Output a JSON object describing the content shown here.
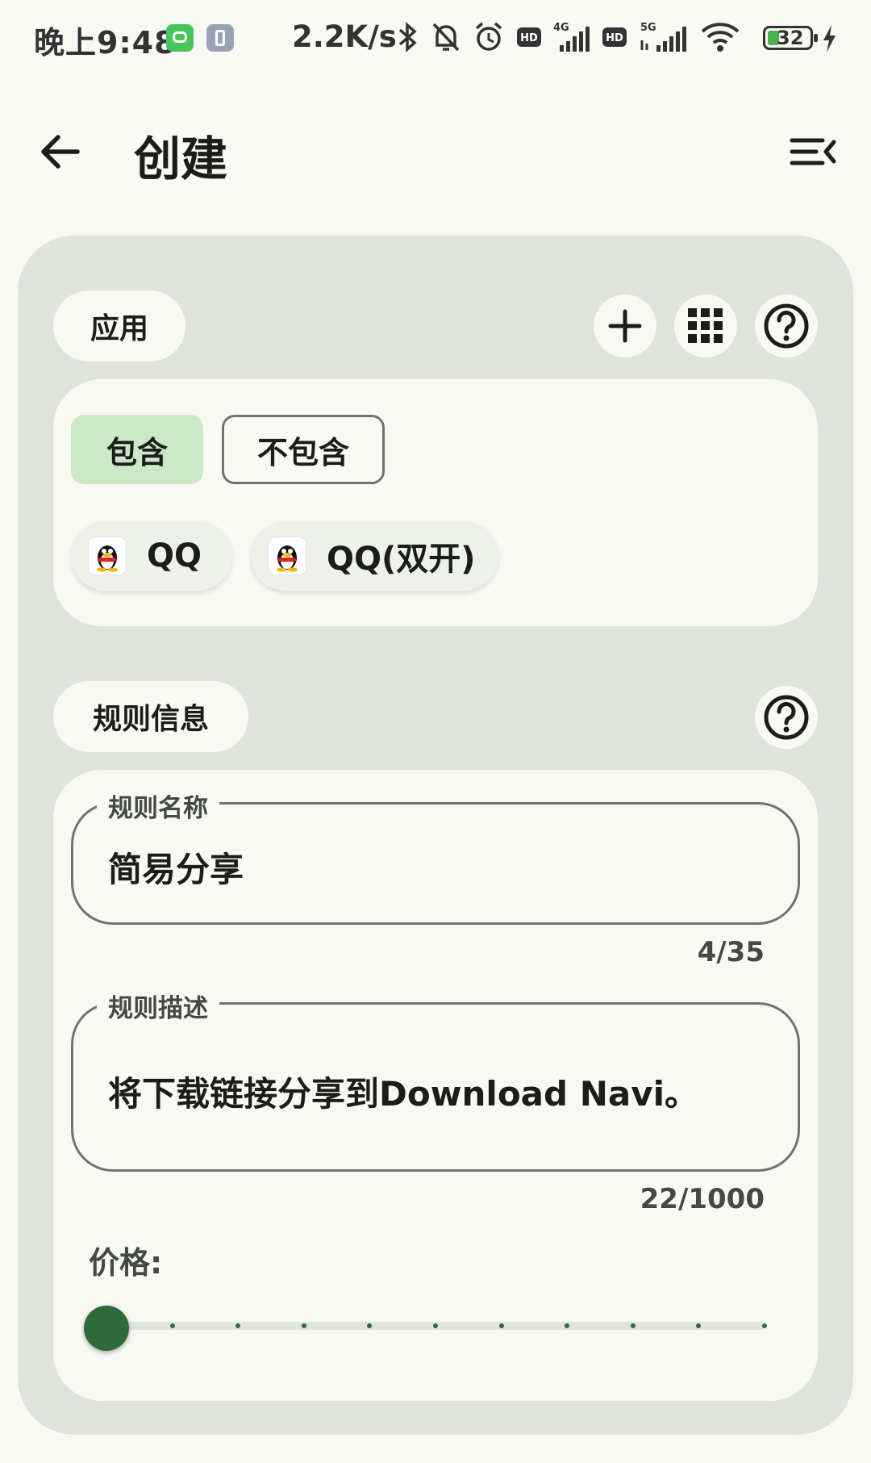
{
  "status_bar": {
    "time": "晚上9:48",
    "net_speed": "2.2K/s",
    "network_labels": [
      "4G",
      "5G"
    ],
    "hd_label": "HD",
    "battery_level": "32",
    "icons": [
      "bluetooth-icon",
      "mute-bell-icon",
      "alarm-icon",
      "hd-icon",
      "signal-4g-icon",
      "signal-5g-icon",
      "wifi-icon",
      "battery-icon",
      "charging-icon"
    ]
  },
  "topbar": {
    "title": "创建",
    "back_icon": "arrow-left-icon",
    "menu_icon": "menu-collapse-icon"
  },
  "apps_section": {
    "header": "应用",
    "actions": [
      "add-icon",
      "grid-icon",
      "help-icon"
    ],
    "filter_chips": [
      {
        "label": "包含",
        "selected": true
      },
      {
        "label": "不包含",
        "selected": false
      }
    ],
    "apps": [
      {
        "name": "QQ",
        "icon": "qq-penguin-icon"
      },
      {
        "name": "QQ(双开)",
        "icon": "qq-penguin-icon"
      }
    ]
  },
  "rule_section": {
    "header": "规则信息",
    "help_icon": "help-icon",
    "name_field": {
      "label": "规则名称",
      "value": "简易分享",
      "counter": "4/35"
    },
    "desc_field": {
      "label": "规则描述",
      "value": "将下载链接分享到Download Navi。",
      "counter": "22/1000"
    },
    "price": {
      "label": "价格:",
      "value": 0,
      "steps": 10
    }
  },
  "colors": {
    "background": "#f8f9f3",
    "card": "#dee3db",
    "chip_selected": "#cde8c9",
    "accent": "#2f6a3a"
  }
}
